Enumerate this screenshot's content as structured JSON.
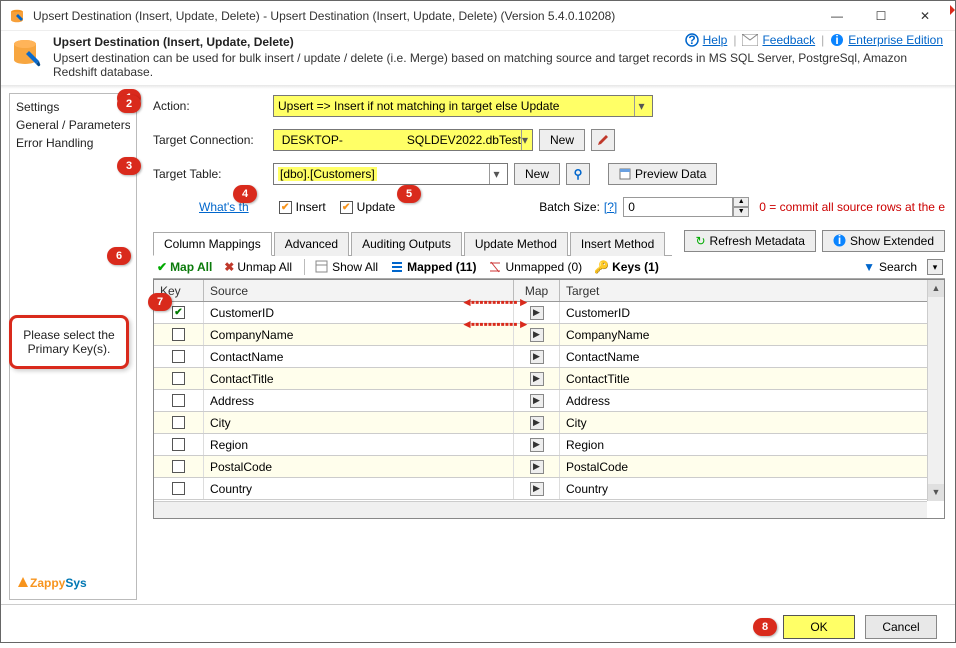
{
  "window": {
    "title": "Upsert Destination (Insert, Update, Delete) - Upsert Destination (Insert, Update, Delete) (Version 5.4.0.10208)"
  },
  "header": {
    "caption": "Upsert Destination (Insert, Update, Delete)",
    "desc": "Upsert destination can be used for bulk insert / update / delete (i.e. Merge) based on matching source and target records in MS SQL Server, PostgreSql, Amazon Redshift database.",
    "help": "Help",
    "feedback": "Feedback",
    "enterprise": "Enterprise Edition"
  },
  "sidebar": {
    "items": [
      "Settings",
      "General / Parameters",
      "Error Handling"
    ]
  },
  "callout": {
    "text": "Please select the Primary Key(s)."
  },
  "form": {
    "action_label": "Action:",
    "action_value": "Upsert => Insert if not matching in target else Update",
    "conn_label": "Target Connection:",
    "conn_value_pre": "DESKTOP-",
    "conn_value_post": "SQLDEV2022.dbTest",
    "new": "New",
    "table_label": "Target Table:",
    "table_value": "[dbo].[Customers]",
    "preview": "Preview Data",
    "whats": "What's th",
    "insert": "Insert",
    "update": "Update",
    "batch_label": "Batch Size:",
    "batch_q": "[?]",
    "batch_val": "0",
    "batch_hint": "0 = commit all source rows at the e",
    "refresh": "Refresh Metadata",
    "extended": "Show Extended"
  },
  "tabs": [
    "Column Mappings",
    "Advanced",
    "Auditing Outputs",
    "Update Method",
    "Insert Method"
  ],
  "toolbar": {
    "mapall": "Map All",
    "unmapall": "Unmap All",
    "showall": "Show All",
    "mapped": "Mapped (11)",
    "unmapped": "Unmapped (0)",
    "keys": "Keys (1)",
    "search": "Search"
  },
  "grid": {
    "h_key": "Key",
    "h_src": "Source",
    "h_map": "Map",
    "h_tgt": "Target",
    "rows": [
      {
        "key": true,
        "src": "CustomerID",
        "tgt": "CustomerID",
        "alt": false
      },
      {
        "key": false,
        "src": "CompanyName",
        "tgt": "CompanyName",
        "alt": true
      },
      {
        "key": false,
        "src": "ContactName",
        "tgt": "ContactName",
        "alt": false
      },
      {
        "key": false,
        "src": "ContactTitle",
        "tgt": "ContactTitle",
        "alt": true
      },
      {
        "key": false,
        "src": "Address",
        "tgt": "Address",
        "alt": false
      },
      {
        "key": false,
        "src": "City",
        "tgt": "City",
        "alt": true
      },
      {
        "key": false,
        "src": "Region",
        "tgt": "Region",
        "alt": false
      },
      {
        "key": false,
        "src": "PostalCode",
        "tgt": "PostalCode",
        "alt": true
      },
      {
        "key": false,
        "src": "Country",
        "tgt": "Country",
        "alt": false
      }
    ]
  },
  "footer": {
    "ok": "OK",
    "cancel": "Cancel"
  },
  "logo": {
    "z": "Zappy",
    "s": "Sys"
  },
  "annotations": [
    "1",
    "2",
    "3",
    "4",
    "5",
    "6",
    "7",
    "8"
  ]
}
